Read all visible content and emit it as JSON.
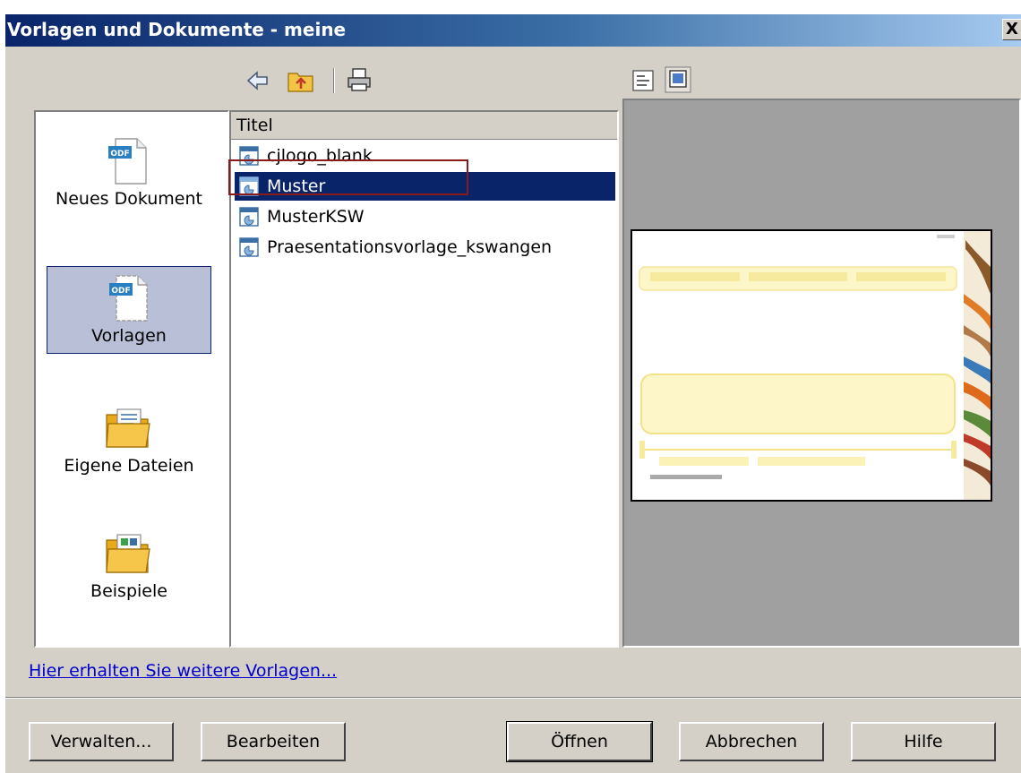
{
  "window": {
    "title": "Vorlagen und Dokumente - meine",
    "close_glyph": "X"
  },
  "toolbar": {
    "left_icons": [
      "back-arrow-icon",
      "folder-up-icon",
      "print-icon"
    ],
    "right_icons": [
      "document-properties-icon",
      "preview-icon"
    ]
  },
  "categories": [
    {
      "label": "Neues Dokument",
      "icon": "odf-document-icon",
      "selected": false
    },
    {
      "label": "Vorlagen",
      "icon": "odf-template-icon",
      "selected": true
    },
    {
      "label": "Eigene Dateien",
      "icon": "folder-documents-icon",
      "selected": false
    },
    {
      "label": "Beispiele",
      "icon": "folder-examples-icon",
      "selected": false
    }
  ],
  "list": {
    "header": "Titel",
    "items": [
      {
        "label": "cjlogo_blank",
        "selected": false
      },
      {
        "label": "Muster",
        "selected": true
      },
      {
        "label": "MusterKSW",
        "selected": false
      },
      {
        "label": "Praesentationsvorlage_kswangen",
        "selected": false
      }
    ]
  },
  "more_templates_link": "Hier erhalten Sie weitere Vorlagen...",
  "buttons": {
    "manage": "Verwalten...",
    "edit": "Bearbeiten",
    "open": "Öffnen",
    "cancel": "Abbrechen",
    "help": "Hilfe"
  },
  "colors": {
    "titlebar": "#0a246a",
    "selection": "#0a246a",
    "dialog_face": "#d4d0c8",
    "link": "#0000cc",
    "focus_outline": "#8b1a1a"
  }
}
